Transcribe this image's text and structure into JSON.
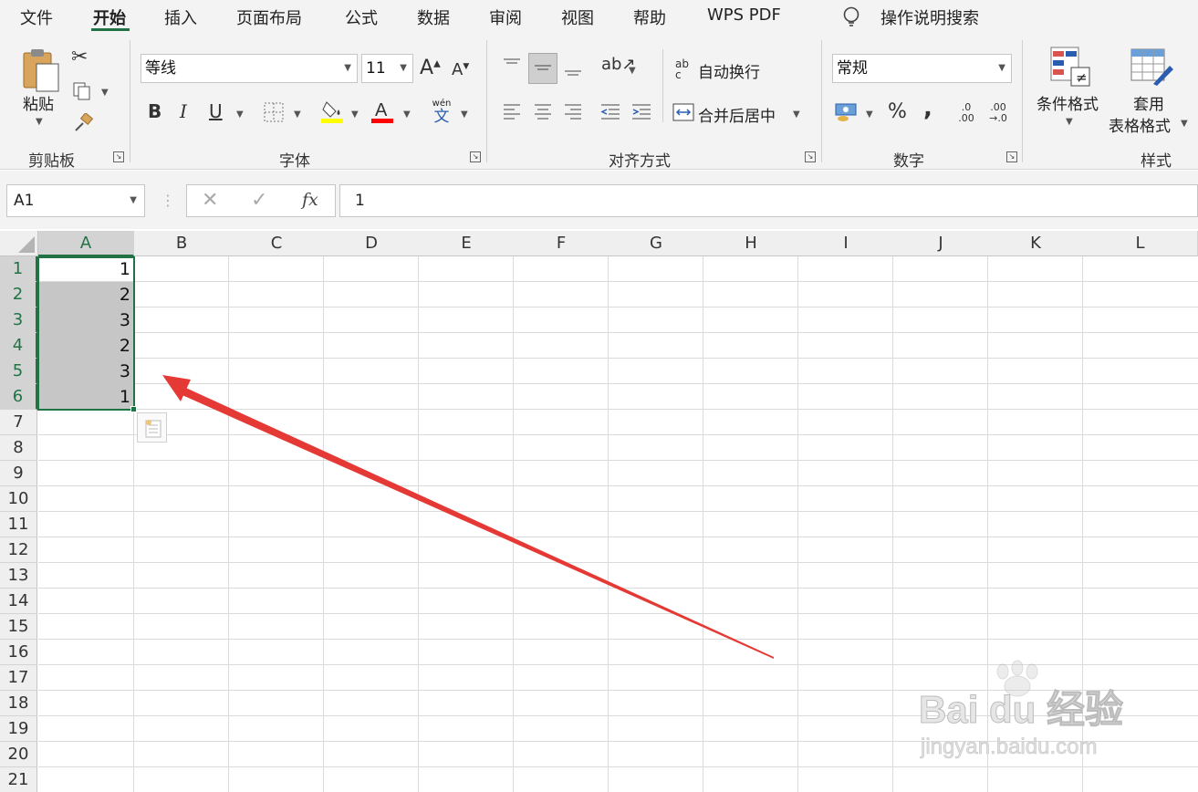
{
  "tabs": [
    "文件",
    "开始",
    "插入",
    "页面布局",
    "公式",
    "数据",
    "审阅",
    "视图",
    "帮助",
    "WPS PDF"
  ],
  "active_tab": "开始",
  "tell_me": "操作说明搜索",
  "clipboard": {
    "paste": "粘贴",
    "group": "剪贴板"
  },
  "font": {
    "name": "等线",
    "size": "11",
    "group": "字体",
    "phonetic_top": "wén",
    "phonetic_bottom": "文"
  },
  "alignment": {
    "wrap": "自动换行",
    "merge": "合并后居中",
    "group": "对齐方式",
    "wrap_icon_top": "ab",
    "wrap_icon_bottom": "c"
  },
  "number": {
    "format": "常规",
    "group": "数字",
    "percent": "%",
    "comma": ",",
    "dec_inc_top": ".0",
    "dec_inc_bottom": ".00",
    "dec_dec_top": ".00",
    "dec_dec_bottom": "→.0"
  },
  "styles": {
    "conditional": "条件格式",
    "table_line1": "套用",
    "table_line2": "表格格式",
    "group": "样式"
  },
  "formula_bar": {
    "name_box": "A1",
    "fx": "fx",
    "content": "1"
  },
  "sheet": {
    "columns": [
      "A",
      "B",
      "C",
      "D",
      "E",
      "F",
      "G",
      "H",
      "I",
      "J",
      "K",
      "L"
    ],
    "rows": [
      "1",
      "2",
      "3",
      "4",
      "5",
      "6",
      "7",
      "8",
      "9",
      "10",
      "11",
      "12",
      "13",
      "14",
      "15",
      "16",
      "17",
      "18",
      "19",
      "20",
      "21"
    ],
    "col_a_values": [
      "1",
      "2",
      "3",
      "2",
      "3",
      "1"
    ],
    "selected_range": "A1:A6"
  },
  "colors": {
    "accent_green": "#217346",
    "annotation_arrow": "#e53935",
    "highlight_yellow": "#ffff00",
    "font_red": "#ff0000"
  },
  "watermark": {
    "brand": "Bai du 经验",
    "url": "jingyan.baidu.com"
  }
}
